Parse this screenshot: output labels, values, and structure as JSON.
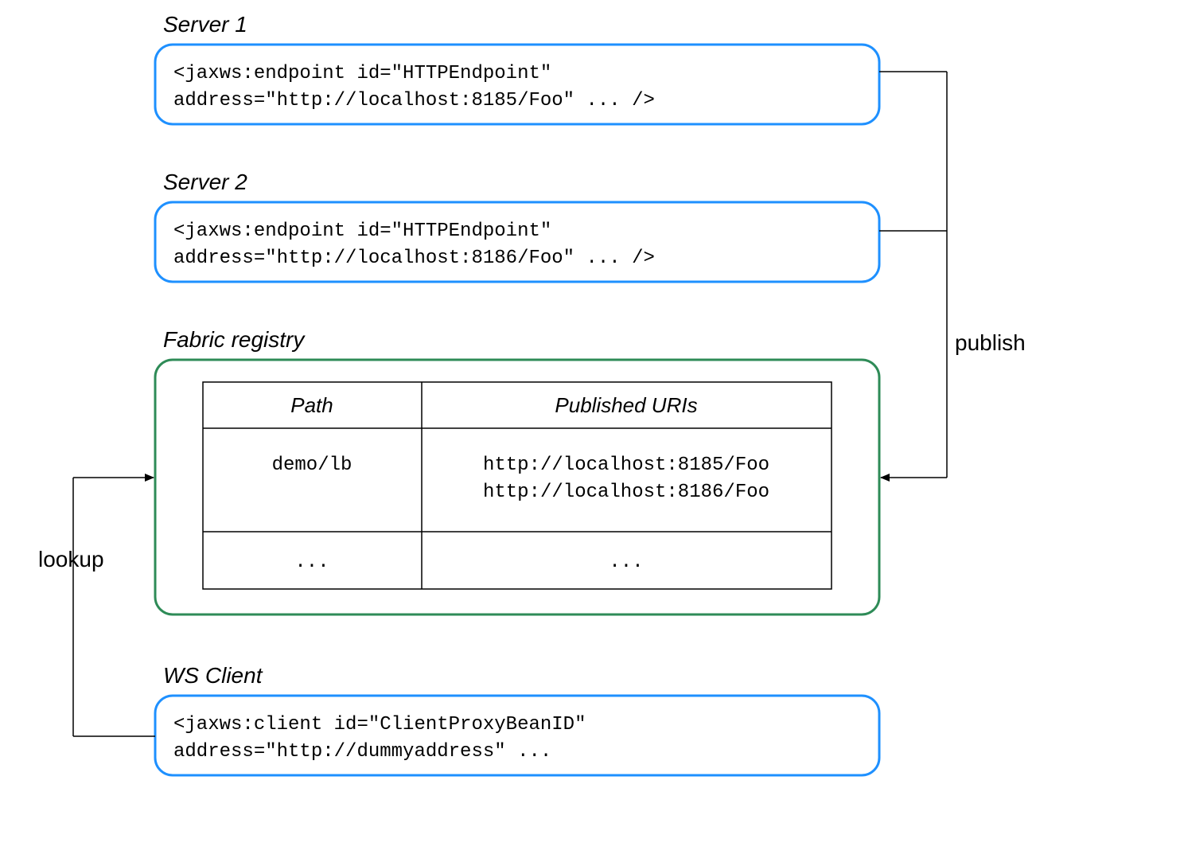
{
  "server1": {
    "title": "Server 1",
    "line1": "<jaxws:endpoint id=\"HTTPEndpoint\"",
    "line2": "    address=\"http://localhost:8185/Foo\" ... />"
  },
  "server2": {
    "title": "Server 2",
    "line1": "<jaxws:endpoint id=\"HTTPEndpoint\"",
    "line2": "    address=\"http://localhost:8186/Foo\" ... />"
  },
  "registry": {
    "title": "Fabric registry",
    "headers": {
      "path": "Path",
      "uris": "Published URIs"
    },
    "row1": {
      "path": "demo/lb",
      "uri1": "http://localhost:8185/Foo",
      "uri2": "http://localhost:8186/Foo"
    },
    "row2": {
      "path": "...",
      "uris": "..."
    }
  },
  "client": {
    "title": "WS Client",
    "line1": "<jaxws:client id=\"ClientProxyBeanID\"",
    "line2": "    address=\"http://dummyaddress\" ..."
  },
  "labels": {
    "publish": "publish",
    "lookup": "lookup"
  }
}
